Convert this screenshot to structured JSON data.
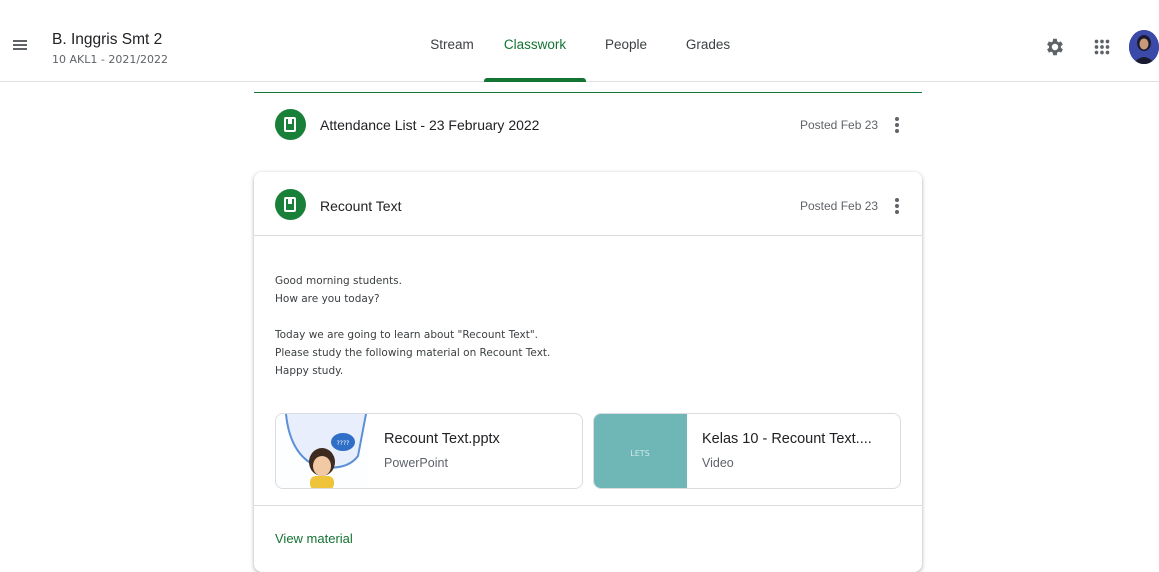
{
  "header": {
    "class_title": "B. Inggris Smt 2",
    "class_subtitle": "10 AKL1 - 2021/2022",
    "tabs": [
      {
        "label": "Stream"
      },
      {
        "label": "Classwork"
      },
      {
        "label": "People"
      },
      {
        "label": "Grades"
      }
    ],
    "active_tab": "Classwork",
    "icons": [
      "menu-icon",
      "settings-icon",
      "apps-icon",
      "avatar"
    ]
  },
  "colors": {
    "accent": "#137333",
    "material_icon_bg": "#188038",
    "video_thumb": "#6fb7b7"
  },
  "items": [
    {
      "title": "Attendance List - 23 February 2022",
      "posted": "Posted Feb 23"
    },
    {
      "title": "Recount Text",
      "posted": "Posted Feb 23",
      "description": [
        "Good morning students.",
        "How are you today?",
        "",
        "Today we are going to learn about \"Recount Text\".",
        "Please study the following material on Recount Text.",
        "Happy study."
      ],
      "attachments": [
        {
          "title": "Recount Text.pptx",
          "type": "PowerPoint",
          "thumb_text": "????"
        },
        {
          "title": "Kelas 10 - Recount Text....",
          "type": "Video",
          "thumb_text": "LETS"
        }
      ],
      "view_label": "View material"
    }
  ]
}
